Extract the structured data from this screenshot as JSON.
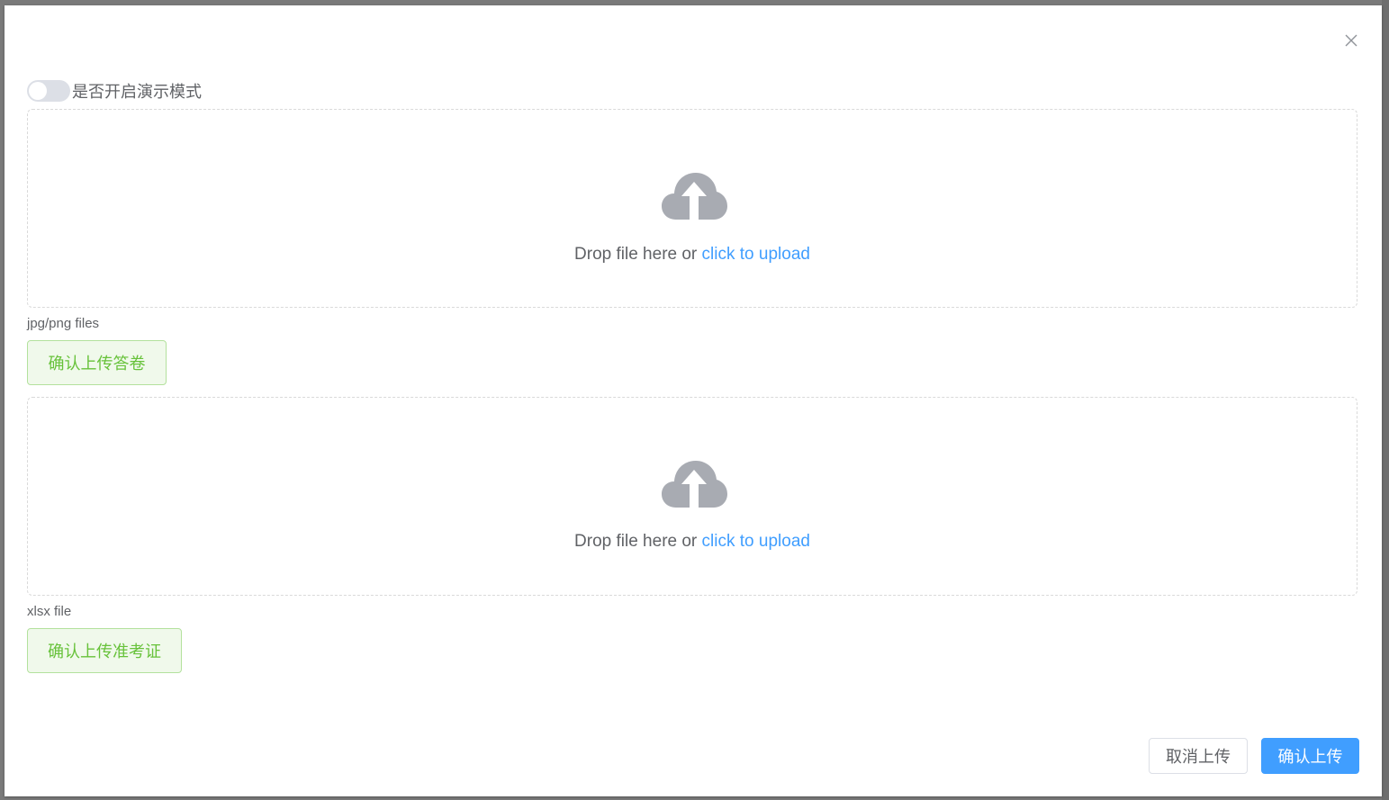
{
  "dialog": {
    "close_icon": "close-icon"
  },
  "demo_switch": {
    "label": "是否开启演示模式",
    "enabled": false
  },
  "uploads": [
    {
      "icon": "upload-cloud-icon",
      "drop_text": "Drop file here or ",
      "click_text": "click to upload",
      "tip": "jpg/png files",
      "confirm_label": "确认上传答卷"
    },
    {
      "icon": "upload-cloud-icon",
      "drop_text": "Drop file here or ",
      "click_text": "click to upload",
      "tip": "xlsx file",
      "confirm_label": "确认上传准考证"
    }
  ],
  "footer": {
    "cancel_label": "取消上传",
    "confirm_label": "确认上传"
  },
  "colors": {
    "primary": "#409eff",
    "success": "#67c23a",
    "success_bg": "#f0f9eb",
    "text": "#606266",
    "icon_gray": "#a8abb2"
  }
}
